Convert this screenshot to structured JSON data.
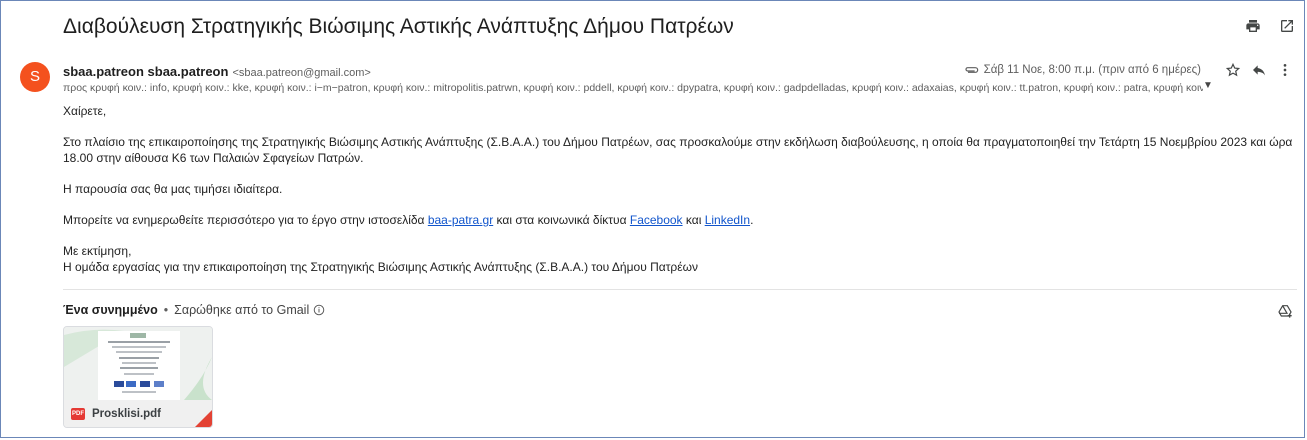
{
  "email": {
    "subject": "Διαβούλευση Στρατηγικής Βιώσιμης Αστικής Ανάπτυξης Δήμου Πατρέων",
    "sender": {
      "avatar_letter": "S",
      "name": "sbaa.patreon sbaa.patreon",
      "email": "<sbaa.patreon@gmail.com>"
    },
    "recipients": "προς κρυφή κοιν.: info, κρυφή κοιν.: kke, κρυφή κοιν.: i−m−patron, κρυφή κοιν.: mitropolitis.patrwn, κρυφή κοιν.: pddell, κρυφή κοιν.: dpypatra, κρυφή κοιν.: gadpdelladas, κρυφή κοιν.: adaxaias, κρυφή κοιν.: tt.patron, κρυφή κοιν.: patra, κρυφή κοιν.: infode",
    "date": "Σάβ 11 Νοε, 8:00 π.μ. (πριν από 6 ημέρες)",
    "body": {
      "greeting": "Χαίρετε,",
      "paragraph1": "Στο πλαίσιο της επικαιροποίησης της Στρατηγικής Βιώσιμης Αστικής Ανάπτυξης (Σ.Β.Α.Α.) του Δήμου Πατρέων, σας προσκαλούμε στην εκδήλωση διαβούλευσης, η οποία θα πραγματοποιηθεί την Τετάρτη 15 Νοεμβρίου 2023 και ώρα 18.00 στην αίθουσα Κ6 των Παλαιών Σφαγείων Πατρών.",
      "paragraph2": "Η παρουσία σας θα μας τιμήσει ιδιαίτερα.",
      "p3_prefix": "Μπορείτε να ενημερωθείτε περισσότερο για το έργο στην ιστοσελίδα ",
      "p3_link1": "baa-patra.gr",
      "p3_middle": " και στα κοινωνικά δίκτυα ",
      "p3_link2": "Facebook",
      "p3_and": " και ",
      "p3_link3": "LinkedIn",
      "p3_suffix": ".",
      "closing": "Με εκτίμηση,",
      "signature": "Η ομάδα εργασίας για την επικαιροποίηση της Στρατηγικής Βιώσιμης Αστικής Ανάπτυξης (Σ.Β.Α.Α.) του Δήμου Πατρέων"
    },
    "attachments": {
      "title": "Ένα συνημμένο",
      "separator": "•",
      "scan_text": "Σαρώθηκε από το Gmail",
      "files": [
        {
          "name": "Prosklisi.pdf",
          "type_badge": "PDF"
        }
      ]
    }
  },
  "icons": {
    "print": "print-icon",
    "open_new_window": "open-in-new-window-icon",
    "attachment": "paperclip-icon",
    "star": "star-icon",
    "reply": "reply-icon",
    "more": "more-vert-icon",
    "expand": "chevron-down-icon",
    "info": "info-icon",
    "drive": "add-to-drive-icon"
  },
  "colors": {
    "avatar": "#f4511e",
    "link": "#1155cc",
    "pdf_badge": "#e53935"
  }
}
